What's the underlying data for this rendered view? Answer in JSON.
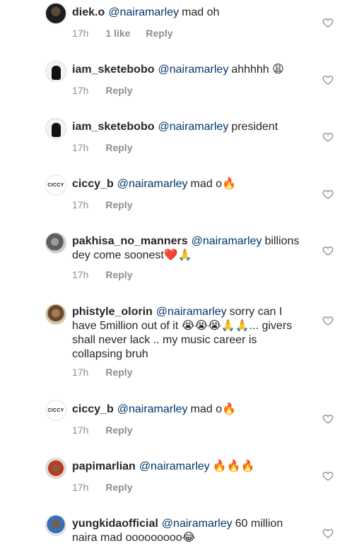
{
  "comments": [
    {
      "username": "diek.o",
      "mention": "@nairamarley",
      "text": "mad oh",
      "time": "17h",
      "likes": "1 like",
      "reply": "Reply",
      "avatar_icon": "user-photo-icon"
    },
    {
      "username": "iam_sketebobo",
      "mention": "@nairamarley",
      "text": "ahhhhh 😩",
      "time": "17h",
      "likes": "",
      "reply": "Reply",
      "avatar_icon": "user-photo-icon"
    },
    {
      "username": "iam_sketebobo",
      "mention": "@nairamarley",
      "text": "president",
      "time": "17h",
      "likes": "",
      "reply": "Reply",
      "avatar_icon": "user-photo-icon"
    },
    {
      "username": "ciccy_b",
      "mention": "@nairamarley",
      "text": "mad o🔥",
      "time": "17h",
      "likes": "",
      "reply": "Reply",
      "avatar_logo": "CICCY"
    },
    {
      "username": "pakhisa_no_manners",
      "mention": "@nairamarley",
      "text": "billions dey come soonest❤️🙏",
      "time": "17h",
      "likes": "",
      "reply": "Reply",
      "avatar_icon": "user-photo-icon"
    },
    {
      "username": "phistyle_olorin",
      "mention": "@nairamarley",
      "text": "sorry can I have 5million out of it 😭😭😭🙏🙏... givers shall never lack .. my music career is collapsing bruh",
      "time": "17h",
      "likes": "",
      "reply": "Reply",
      "avatar_icon": "user-photo-icon"
    },
    {
      "username": "ciccy_b",
      "mention": "@nairamarley",
      "text": "mad o🔥",
      "time": "17h",
      "likes": "",
      "reply": "Reply",
      "avatar_logo": "CICCY"
    },
    {
      "username": "papimarlian",
      "mention": "@nairamarley",
      "text": "🔥🔥🔥",
      "time": "17h",
      "likes": "",
      "reply": "Reply",
      "avatar_icon": "user-photo-icon"
    },
    {
      "username": "yungkidaofficial",
      "mention": "@nairamarley",
      "text": "60 million naira mad ooooooooo😂",
      "time": "",
      "likes": "",
      "reply": "",
      "avatar_icon": "user-photo-icon"
    }
  ],
  "heart_icon": "heart-outline-icon",
  "colors": {
    "username": "#262626",
    "mention": "#00376b",
    "meta": "#8e8e8e",
    "heart": "#8e8e8e"
  }
}
